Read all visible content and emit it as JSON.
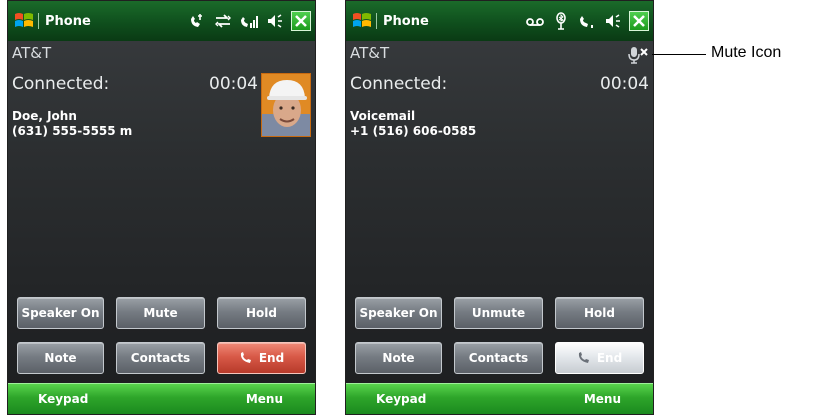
{
  "screens": [
    {
      "title": "Phone",
      "carrier": "AT&T",
      "status": "Connected:",
      "timer": "00:04",
      "caller_name": "Doe, John",
      "caller_number": "(631) 555-5555 m",
      "buttons": {
        "speaker": "Speaker On",
        "mute": "Mute",
        "hold": "Hold",
        "note": "Note",
        "contacts": "Contacts",
        "end": "End"
      },
      "softkeys": {
        "left": "Keypad",
        "right": "Menu"
      },
      "icons": [
        "windows-flag-icon",
        "call-indicator-icon",
        "data-connection-icon",
        "signal-strength-icon",
        "speaker-volume-icon",
        "close-icon"
      ]
    },
    {
      "title": "Phone",
      "carrier": "AT&T",
      "status": "Connected:",
      "timer": "00:04",
      "caller_name": "Voicemail",
      "caller_number": "+1 (516) 606-0585",
      "buttons": {
        "speaker": "Speaker On",
        "mute": "Unmute",
        "hold": "Hold",
        "note": "Note",
        "contacts": "Contacts",
        "end": "End"
      },
      "softkeys": {
        "left": "Keypad",
        "right": "Menu"
      },
      "icons": [
        "windows-flag-icon",
        "voicemail-icon",
        "bluetooth-icon",
        "signal-strength-icon",
        "speaker-volume-icon",
        "close-icon",
        "mute-icon"
      ]
    }
  ],
  "callout": {
    "label": "Mute Icon"
  },
  "colors": {
    "title_green": "#0f4f1d",
    "softkey_green": "#2ea52a",
    "end_red": "#d85a48",
    "button_gray": "#767c83"
  }
}
